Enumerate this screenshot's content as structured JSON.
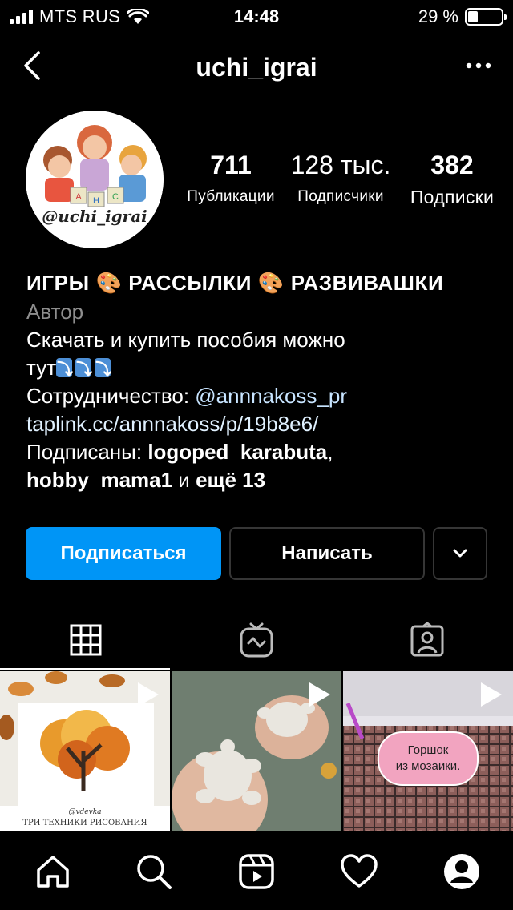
{
  "status_bar": {
    "carrier": "MTS RUS",
    "time": "14:48",
    "battery": "29 %",
    "battery_level": 0.29
  },
  "header": {
    "username": "uchi_igrai"
  },
  "profile": {
    "avatar_caption": "@uchi_igrai",
    "stats": [
      {
        "value": "711",
        "label": "Публикации"
      },
      {
        "value": "128 тыс.",
        "label": "Подписчики"
      },
      {
        "value": "382",
        "label": "Подписки"
      }
    ]
  },
  "bio": {
    "name_part1": "ИГРЫ",
    "name_part2": "РАССЫЛКИ",
    "name_part3": "РАЗВИВАШКИ",
    "category": "Автор",
    "line1": "Скачать и купить пособия можно",
    "line2": "тут",
    "collab_label": "Сотрудничество: ",
    "collab_handle": "@annnakoss_pr",
    "link": "taplink.cc/annnakoss/p/19b8e6/",
    "followed_prefix": "Подписаны: ",
    "followed_user1": "logoped_karabuta",
    "followed_sep": ",",
    "followed_user2": "hobby_mama1",
    "followed_mid": " и ",
    "followed_more": "ещё 13"
  },
  "buttons": {
    "follow": "Подписаться",
    "message": "Написать"
  },
  "tabs": [
    "grid",
    "igtv",
    "tagged"
  ],
  "posts": [
    {
      "caption": "ТРИ ТЕХНИКИ РИСОВАНИЯ",
      "signature": "@vdevka"
    },
    {
      "caption": ""
    },
    {
      "caption": "Горшок из мозаики."
    }
  ],
  "colors": {
    "background": "#000000",
    "accent": "#0095f6",
    "link": "#e0f1ff",
    "muted": "#8e8e8e"
  },
  "icons": [
    "back-icon",
    "more-icon",
    "grid-icon",
    "igtv-icon",
    "tagged-icon",
    "play-icon",
    "home-icon",
    "search-icon",
    "reels-icon",
    "heart-icon",
    "profile-icon"
  ]
}
